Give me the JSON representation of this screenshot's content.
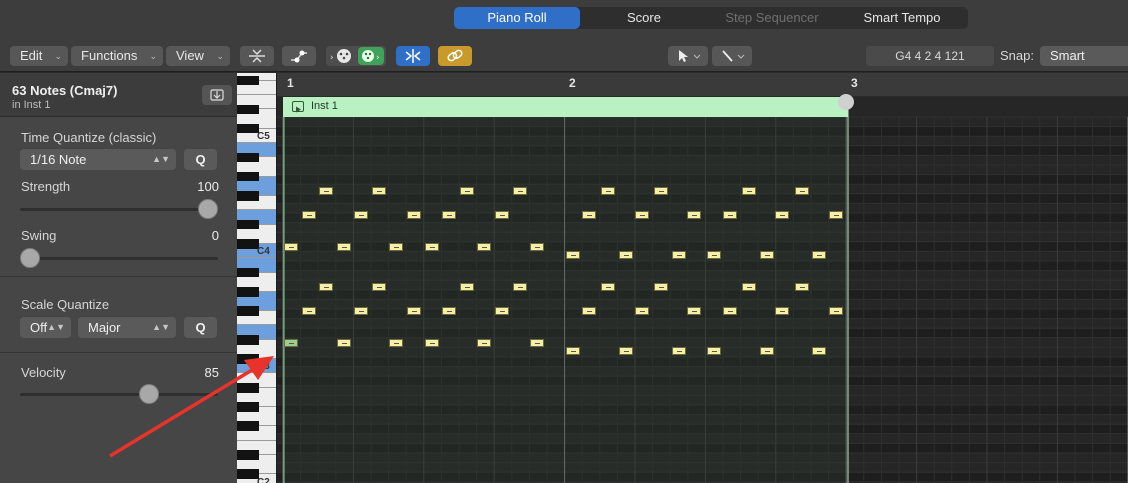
{
  "tabs": [
    {
      "label": "Piano Roll",
      "state": "active"
    },
    {
      "label": "Score",
      "state": "normal"
    },
    {
      "label": "Step Sequencer",
      "state": "disabled"
    },
    {
      "label": "Smart Tempo",
      "state": "normal"
    }
  ],
  "toolbar": {
    "edit_label": "Edit",
    "functions_label": "Functions",
    "view_label": "View",
    "lcd_text": "G4   4 2 4 121",
    "snap_label": "Snap:",
    "snap_value": "Smart"
  },
  "inspector": {
    "title": "63 Notes (Cmaj7)",
    "subtitle": "in Inst 1",
    "time_quantize": {
      "label": "Time Quantize (classic)",
      "value": "1/16 Note",
      "q_label": "Q"
    },
    "strength": {
      "label": "Strength",
      "value": "100",
      "level": 1.0
    },
    "swing": {
      "label": "Swing",
      "value": "0",
      "level": 0.0
    },
    "scale_quantize": {
      "label": "Scale Quantize",
      "mode": "Off",
      "scale": "Major",
      "q_label": "Q"
    },
    "velocity": {
      "label": "Velocity",
      "value": "85",
      "level": 0.67
    }
  },
  "keyboard": {
    "labels": [
      "C5",
      "C4",
      "C3",
      "C2"
    ]
  },
  "ruler": {
    "bars": [
      "1",
      "2",
      "3"
    ]
  },
  "region": {
    "name": "Inst 1",
    "color": "#b9f1c2"
  },
  "colors": {
    "accent": "#2f6fc7",
    "note": "#f6f0a4",
    "annotation_arrow": "#e8332a"
  },
  "icons": [
    "download-icon",
    "collapse-icon",
    "automation-icon",
    "midi-in-icon",
    "midi-out-icon",
    "catch-icon",
    "link-icon",
    "pointer-tool-icon",
    "pencil-tool-icon"
  ]
}
